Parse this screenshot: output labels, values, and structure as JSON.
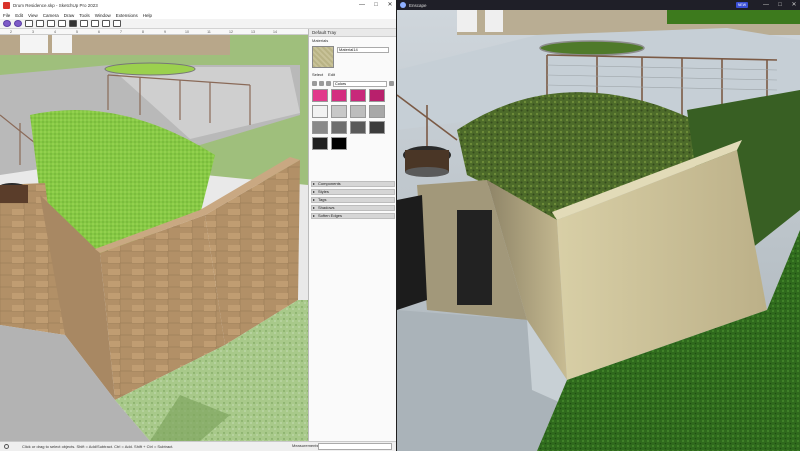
{
  "sketchup": {
    "title": "Drum Residence.skp - SketchUp Pro 2023",
    "window_controls": [
      "—",
      "□",
      "✕"
    ],
    "menu": [
      "File",
      "Edit",
      "View",
      "Camera",
      "Draw",
      "Tools",
      "Window",
      "Extensions",
      "Help"
    ],
    "ruler": [
      "2",
      "3",
      "4",
      "5",
      "6",
      "7",
      "8",
      "9",
      "10",
      "11",
      "12",
      "13",
      "14"
    ],
    "tray": {
      "title": "Default Tray",
      "materials_header": "Materials",
      "material_name": "Material14",
      "tabs": [
        "Select",
        "Edit"
      ],
      "collection": "Colors",
      "swatch_colors": [
        "#e23a8c",
        "#d42d80",
        "#c8287a",
        "#b8206c",
        "#f2f2f2",
        "#c8c8c8",
        "#bdbdbd",
        "#a8a8a8",
        "#8a8a8a",
        "#6e6e6e",
        "#5a5a5a",
        "#3c3c3c",
        "#202020",
        "#000000"
      ],
      "panels": [
        "Components",
        "Styles",
        "Tags",
        "Shadows",
        "Soften Edges"
      ]
    },
    "status": {
      "message": "Click or drag to select objects. Shift = Add/Subtract. Ctrl = Add. Shift + Ctrl = Subtract.",
      "measurements_label": "Measurements"
    }
  },
  "enscape": {
    "title": "Enscape",
    "badge": "NEW",
    "window_controls": [
      "—",
      "□",
      "✕"
    ]
  },
  "colors": {
    "sketchup_grass": "#8fd14a",
    "sketchup_wall": "#b08e63",
    "enscape_grass": "#3c7a24",
    "enscape_wall": "#c7bd93"
  }
}
